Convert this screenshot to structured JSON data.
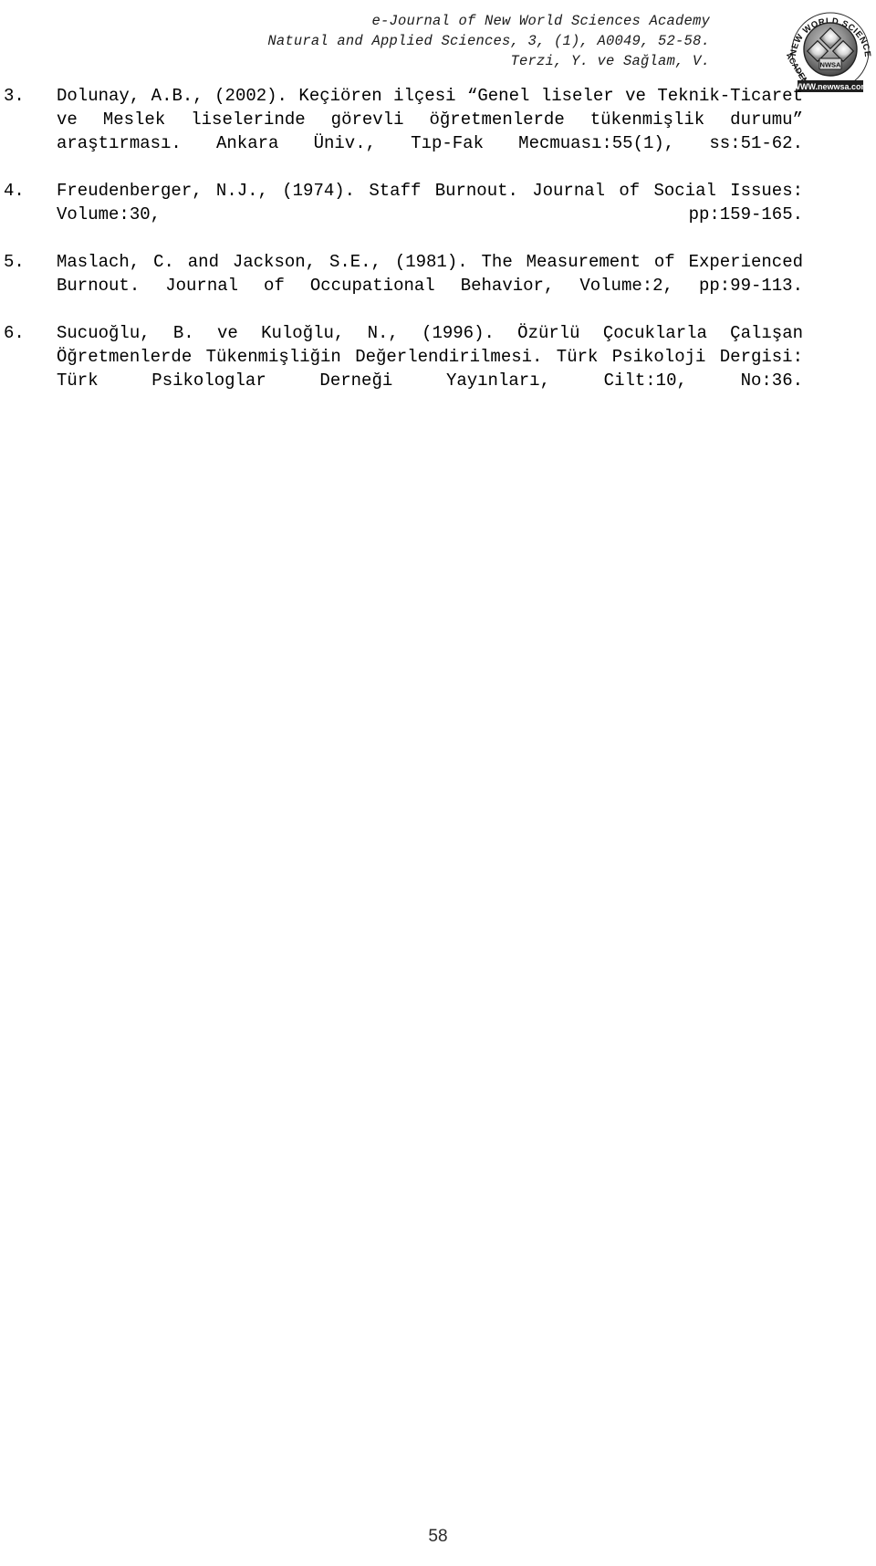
{
  "document": {
    "title": "e-Journal of New World Sciences Academy",
    "page_number": "58"
  },
  "header": {
    "line1": "e-Journal of New World Sciences Academy",
    "line2": "Natural and Applied Sciences, 3, (1), A0049, 52-58.",
    "line3": "Terzi, Y. ve Sağlam, V.",
    "logo": {
      "icon": "newwsa-seal-logo",
      "arc_top_text": "NEW WORLD SCIENCES",
      "arc_right_text": "ACADEMY",
      "center_text": "NWSA",
      "url_text": "WWW.newwsa.com"
    }
  },
  "references": [
    {
      "number": "3.",
      "text": "Dolunay, A.B., (2002). Keçiören ilçesi “Genel liseler ve Teknik-Ticaret ve Meslek liselerinde görevli öğretmenlerde tükenmişlik durumu” araştırması. Ankara Üniv., Tıp-Fak Mecmuası:55(1), ss:51-62."
    },
    {
      "number": "4.",
      "text": "Freudenberger, N.J., (1974). Staff Burnout. Journal of Social Issues: Volume:30, pp:159-165."
    },
    {
      "number": "5.",
      "text": "Maslach, C. and Jackson, S.E., (1981). The Measurement of Experienced Burnout. Journal of Occupational Behavior, Volume:2, pp:99-113."
    },
    {
      "number": "6.",
      "text": "Sucuoğlu, B. ve Kuloğlu, N., (1996). Özürlü Çocuklarla Çalışan Öğretmenlerde Tükenmişliğin Değerlendirilmesi. Türk Psikoloji Dergisi: Türk Psikologlar Derneği Yayınları, Cilt:10, No:36."
    }
  ]
}
